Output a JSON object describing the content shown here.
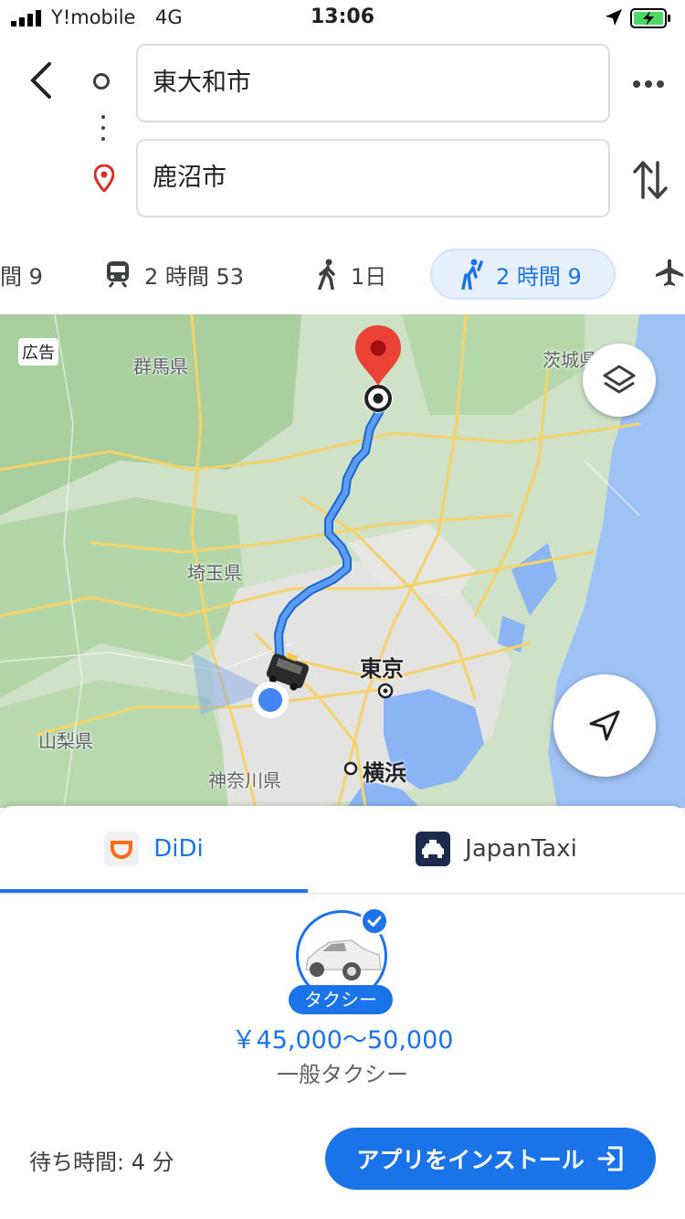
{
  "status_bar": {
    "carrier": "Y!mobile",
    "network": "4G",
    "time": "13:06"
  },
  "route": {
    "origin": "東大和市",
    "destination": "鹿沼市"
  },
  "modes": [
    {
      "icon": "car-icon",
      "label": "間 9"
    },
    {
      "icon": "train-icon",
      "label": "2 時間 53"
    },
    {
      "icon": "walk-icon",
      "label": "1日"
    },
    {
      "icon": "ride-hailing-icon",
      "label": "2 時間 9",
      "active": true
    },
    {
      "icon": "flight-icon",
      "label": ""
    }
  ],
  "map": {
    "ad_badge": "広告",
    "labels": {
      "gunma": "群馬県",
      "ibaraki": "茨城県",
      "saitama": "埼玉県",
      "tokyo": "東京",
      "yamanashi": "山梨県",
      "kanagawa": "神奈川県",
      "yokohama": "横浜"
    }
  },
  "providers": {
    "didi": "DiDi",
    "japantaxi": "JapanTaxi",
    "selected": "DiDi"
  },
  "ride": {
    "option_label": "タクシー",
    "fare": "￥45,000〜50,000",
    "service": "一般タクシー",
    "wait": "待ち時間: 4 分",
    "install_button": "アプリをインストール"
  },
  "colors": {
    "accent": "#1a73e8",
    "route": "#4f86e8",
    "destination_pin": "#d93025"
  }
}
